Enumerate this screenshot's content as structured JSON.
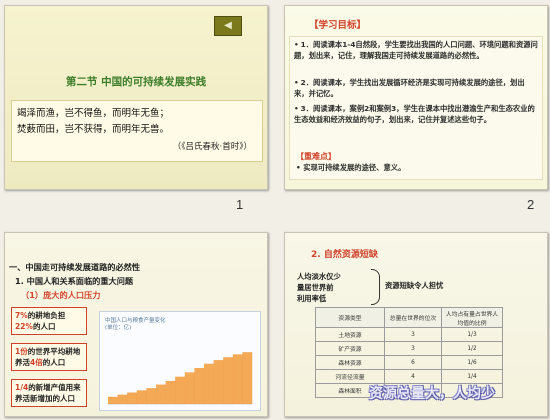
{
  "slides": [
    {
      "number": "1",
      "nav_button": "◀",
      "title": "第二节  中国的可持续发展实践",
      "poem": {
        "line1": "竭泽而渔，岂不得鱼，而明年无鱼；",
        "line2": "焚薮而田，岂不获得，而明年无兽。",
        "source": "（《吕氏春秋·首时》）"
      }
    },
    {
      "number": "2",
      "title": "【学习目标】",
      "objectives": [
        "1．阅读课本1-4自然段，学生要找出我国的人口问题、环境问题和资源问题，划出来，记住，理解我国走可持续发展道路的必然性。",
        "2．阅读课本，学生找出发展循环经济是实现可持续发展的途径，划出来，并记忆。",
        "3．阅读课本，案例2和案例3，学生在课本中找出潜渝生产和生态农业的生态效益和经济效益的句子，划出来，记住并复述这些句子。"
      ],
      "key_title": "【重难点】",
      "key_points": [
        "实现可持续发展的途径、意义。"
      ]
    },
    {
      "number": "",
      "heading1": "一、中国走可持续发展道路的必然性",
      "heading2": "1. 中国人和关系面临的重大问题",
      "heading3": "（1）庞大的人口压力",
      "callouts": [
        {
          "highlight": "7%",
          "rest": "的耕地负担",
          "highlight2": "22%",
          "rest2": "的人口"
        },
        {
          "highlight": "1份",
          "rest": "的世界平均耕地养活",
          "highlight2": "4倍",
          "rest2": "的人口"
        },
        {
          "highlight": "1/4",
          "rest": "的新增产值用来养活新增加的人口",
          "highlight2": "",
          "rest2": ""
        }
      ],
      "chart": {
        "caption": "中国人口与粮食产量变化",
        "sub_caption": "(单位：亿)",
        "bar_fraction_steps": [
          0.1,
          0.13,
          0.16,
          0.19,
          0.22,
          0.27,
          0.32,
          0.38,
          0.44,
          0.5,
          0.56,
          0.61,
          0.65,
          0.69,
          0.72
        ]
      }
    },
    {
      "number": "",
      "title": "2. 自然资源短缺",
      "brace_text": [
        "人均淡水仅少",
        "量居世界前",
        "利用率低"
      ],
      "brace_label": "资源短缺令人担忧",
      "table": {
        "headers": [
          "资源类型",
          "总量在世界的位次",
          "人均占有量占世界人均值的比例"
        ],
        "rows": [
          [
            "土地资源",
            "3",
            "1/3"
          ],
          [
            "矿产资源",
            "3",
            "1/2"
          ],
          [
            "森林资源",
            "6",
            "1/6"
          ],
          [
            "河流径流量",
            "4",
            "1/4"
          ],
          [
            "森林面积",
            "",
            ""
          ]
        ]
      },
      "banner": "资源总量大，人均少"
    }
  ],
  "colors": {
    "accent_red": "#d1442c",
    "title_green": "#3d7e2a",
    "chart_orange": "#f29a3a"
  }
}
